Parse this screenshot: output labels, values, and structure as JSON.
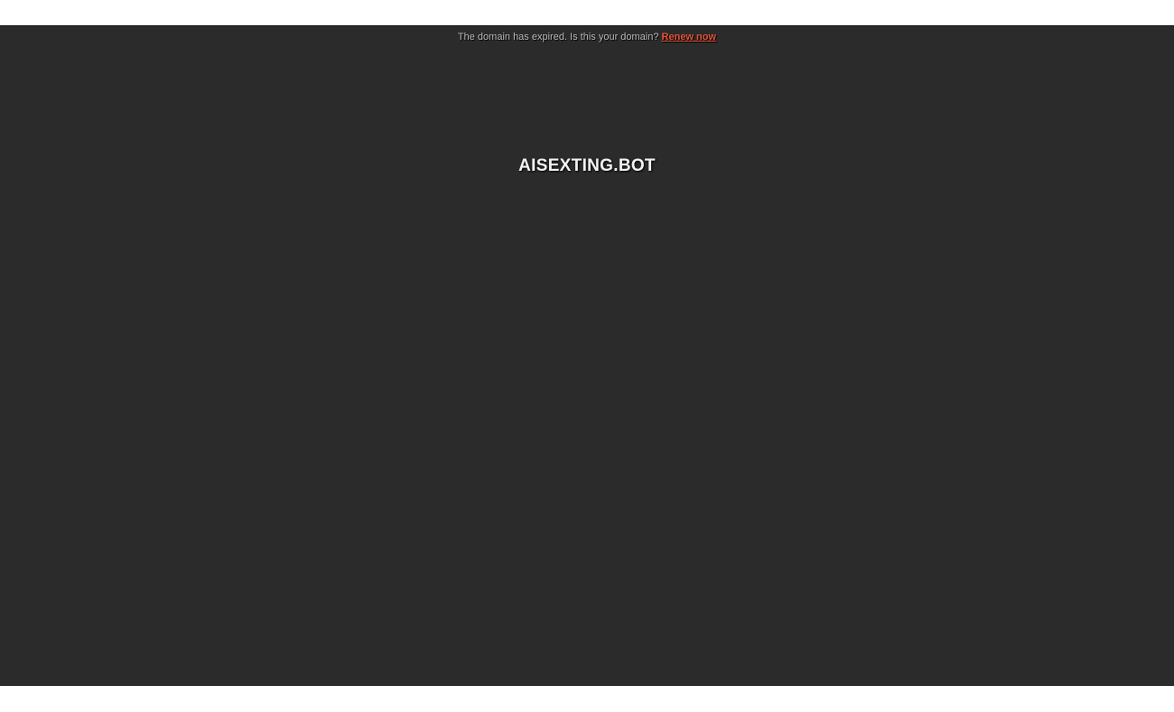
{
  "notice": {
    "message": "The domain has expired. Is this your domain?",
    "link_label": "Renew now",
    "link_color": "#e8533a"
  },
  "domain": {
    "name": "AISEXTING.BOT"
  },
  "colors": {
    "background": "#2b2b2b",
    "text": "#bdbdbd"
  }
}
